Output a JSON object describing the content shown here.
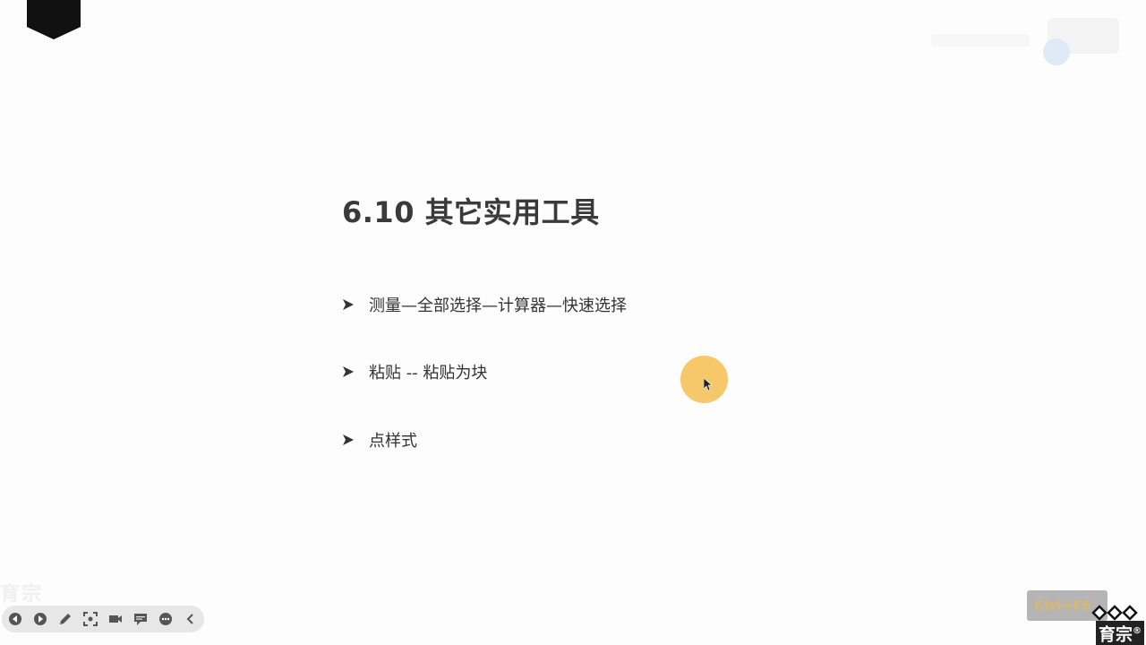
{
  "slide": {
    "title": "6.10 其它实用工具",
    "bullets": [
      "测量—全部选择—计算器—快速选择",
      "粘贴 -- 粘贴为块",
      "点样式"
    ]
  },
  "toolbar": {
    "icons": [
      "prev-icon",
      "next-icon",
      "pen-icon",
      "screenshot-icon",
      "camera-icon",
      "comment-icon",
      "more-icon",
      "collapse-icon"
    ]
  },
  "overlay": {
    "shortcut_label": "Ctrl+F6",
    "brand_text": "育宗",
    "brand_mark": "®",
    "faint_logo": "育宗"
  },
  "colors": {
    "cursor_halo": "#f4be50",
    "toolbar_bg": "#e7e7e7",
    "title": "#3a3a3a"
  }
}
